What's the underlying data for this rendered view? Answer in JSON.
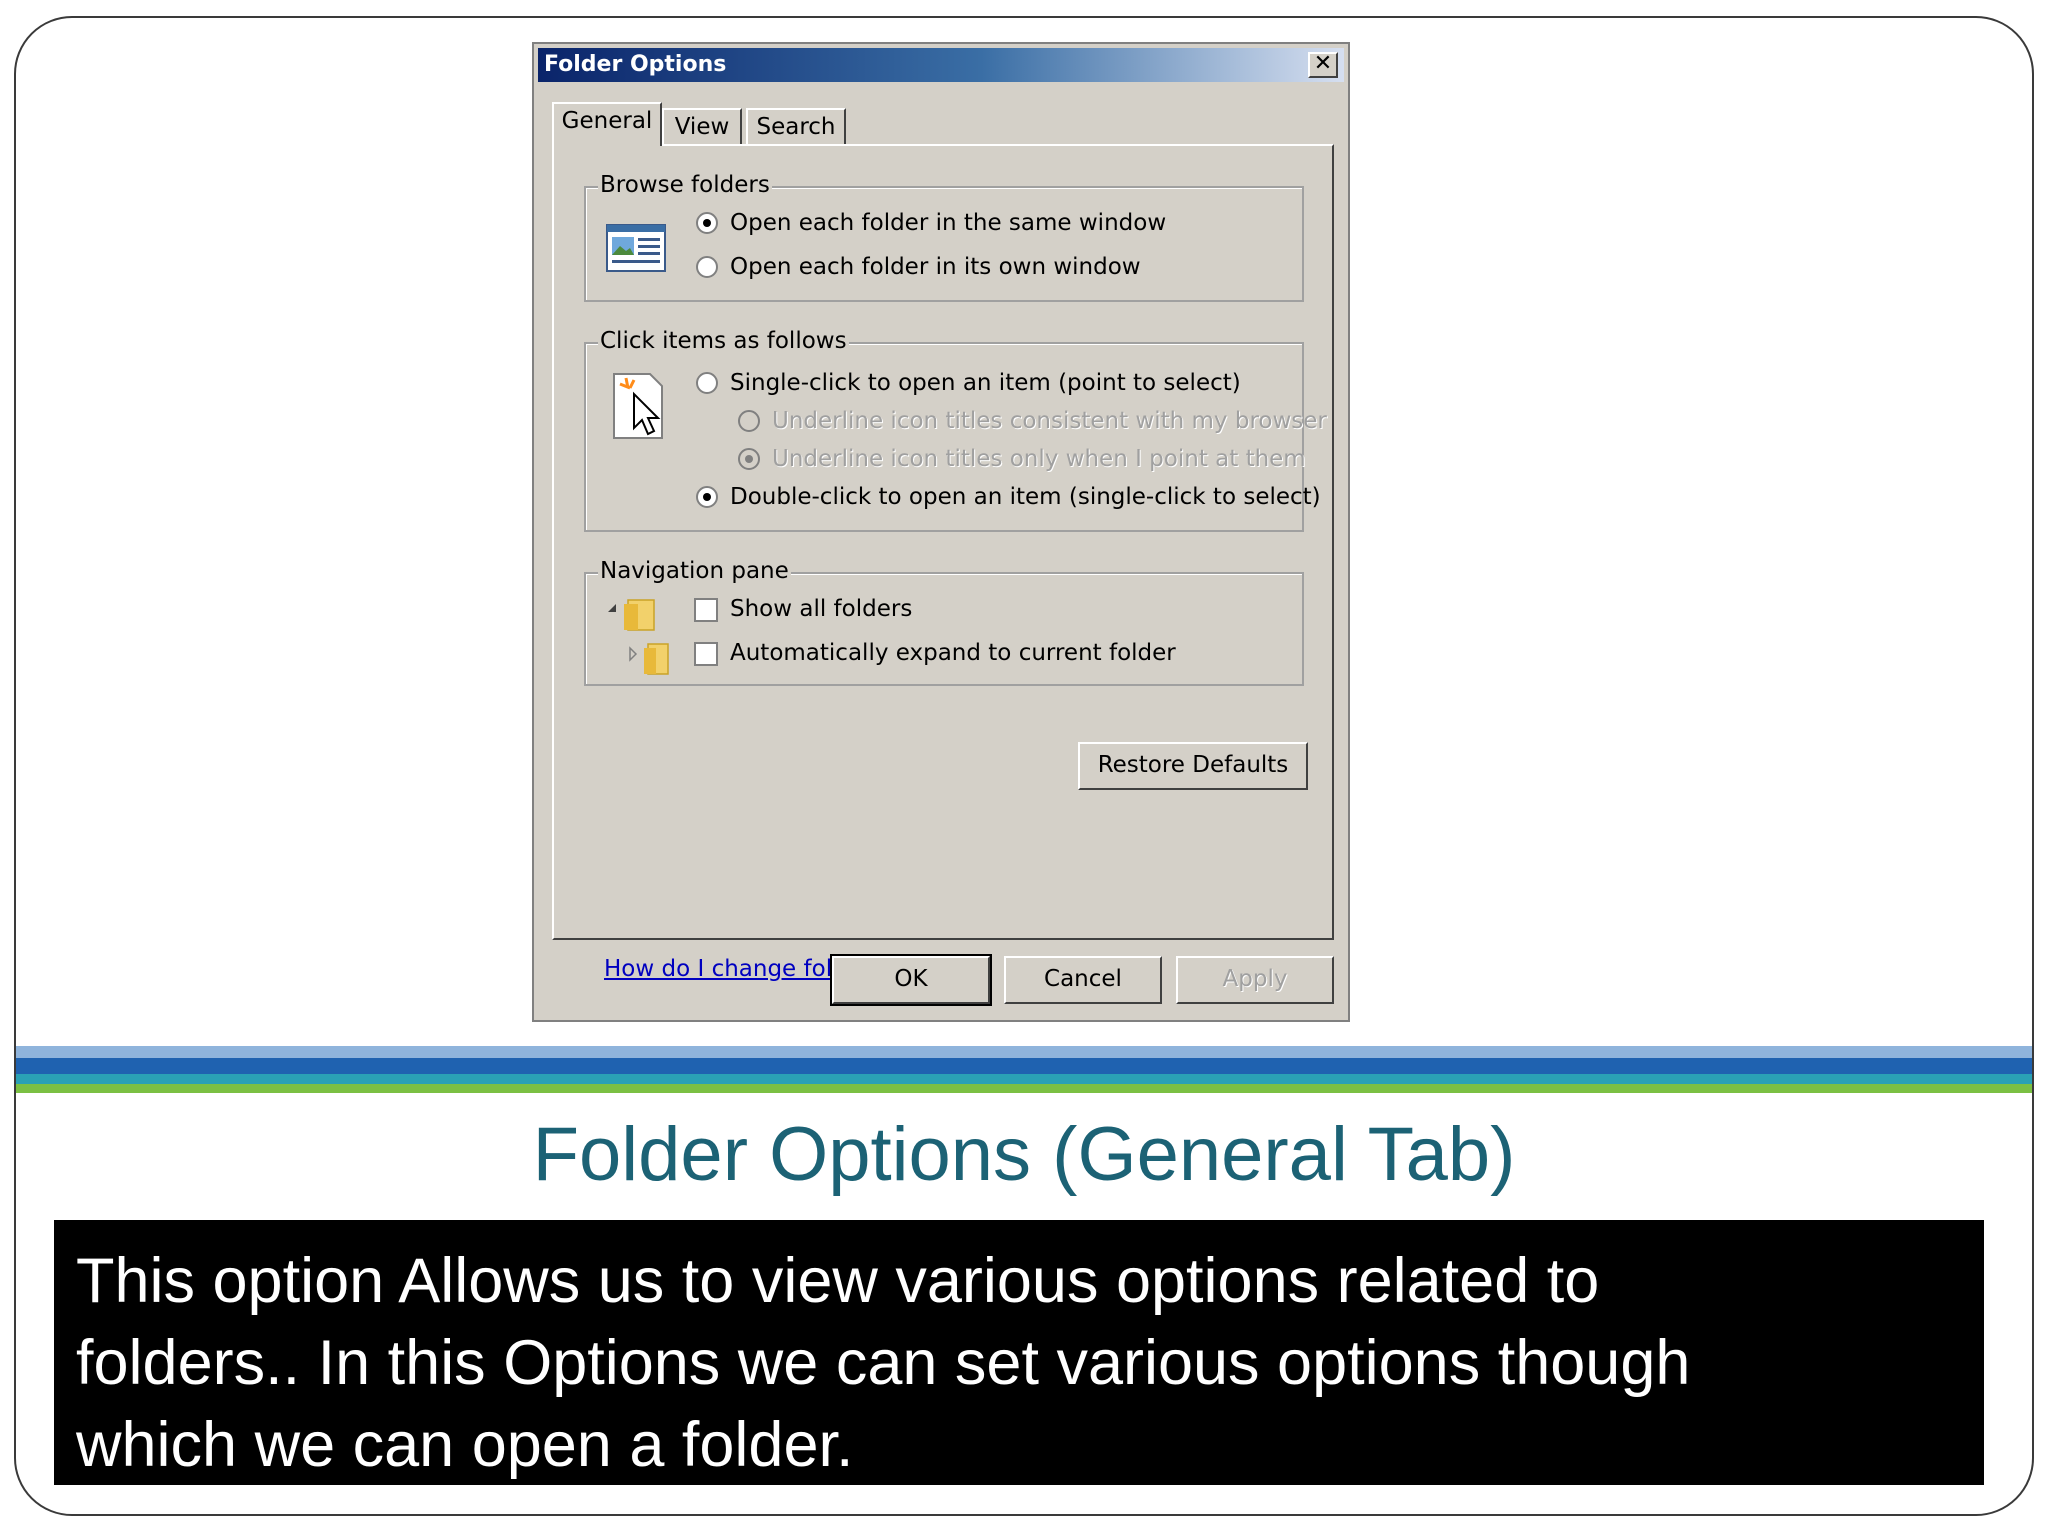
{
  "dialog": {
    "title": "Folder Options",
    "close": "✕",
    "tabs": [
      {
        "label": "General",
        "active": true
      },
      {
        "label": "View",
        "active": false
      },
      {
        "label": "Search",
        "active": false
      }
    ],
    "browse_folders": {
      "label": "Browse folders",
      "options": [
        {
          "label": "Open each folder in the same window",
          "checked": true
        },
        {
          "label": "Open each folder in its own window",
          "checked": false
        }
      ]
    },
    "click_items": {
      "label": "Click items as follows",
      "options": [
        {
          "label": "Single-click to open an item (point to select)",
          "checked": false,
          "disabled": false
        },
        {
          "label": "Underline icon titles consistent with my browser",
          "checked": false,
          "disabled": true
        },
        {
          "label": "Underline icon titles only when I point at them",
          "checked": true,
          "disabled": true
        },
        {
          "label": "Double-click to open an item (single-click to select)",
          "checked": true,
          "disabled": false
        }
      ]
    },
    "navigation_pane": {
      "label": "Navigation pane",
      "options": [
        {
          "label": "Show all folders",
          "checked": false
        },
        {
          "label": "Automatically expand to current folder",
          "checked": false
        }
      ]
    },
    "restore_defaults": "Restore Defaults",
    "help_link": "How do I change folder options?",
    "buttons": {
      "ok": "OK",
      "cancel": "Cancel",
      "apply": "Apply"
    }
  },
  "slide": {
    "title": "Folder Options (General Tab)",
    "caption_line1": "This option Allows us to view various options related to",
    "caption_line2": "folders.. In this Options we can set various options though",
    "caption_line3": "which we can open a folder."
  },
  "colors": {
    "title_text": "#1c6275",
    "dialog_bg": "#d4d0c8",
    "titlebar_start": "#0a246a",
    "link": "#0000c0"
  }
}
